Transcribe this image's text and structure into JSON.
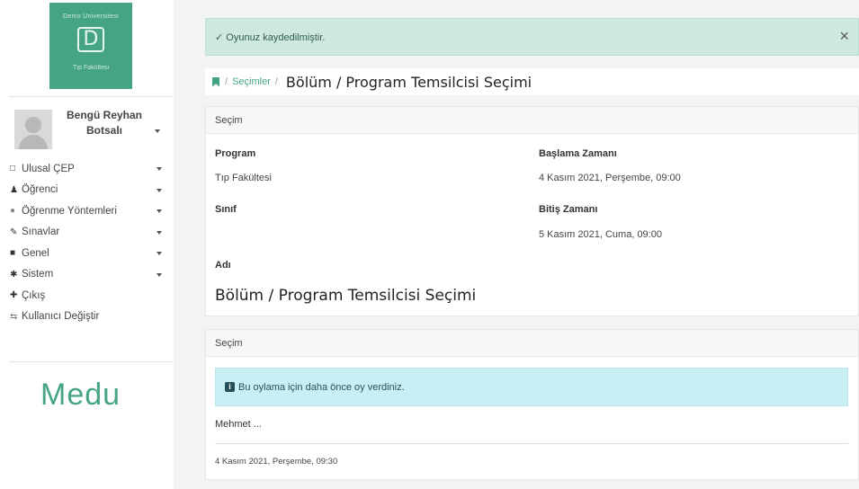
{
  "sidebar": {
    "logo": {
      "top_text": "Demo Üniversitesi",
      "letter": "D",
      "bottom_text": "Tıp Fakültesi"
    },
    "user": {
      "name": "Bengü Reyhan Botsalı"
    },
    "menu": [
      {
        "icon": "book-icon",
        "glyph": "□",
        "label": "Ulusal ÇEP",
        "has_caret": true
      },
      {
        "icon": "user-icon",
        "glyph": "♟",
        "label": "Öğrenci",
        "has_caret": true
      },
      {
        "icon": "circle-icon",
        "glyph": "●",
        "label": "Öğrenme Yöntemleri",
        "has_caret": true
      },
      {
        "icon": "edit-icon",
        "glyph": "✎",
        "label": "Sınavlar",
        "has_caret": true
      },
      {
        "icon": "folder-icon",
        "glyph": "■",
        "label": "Genel",
        "has_caret": true
      },
      {
        "icon": "asterisk-icon",
        "glyph": "✱",
        "label": "Sistem",
        "has_caret": true
      },
      {
        "icon": "signpost-icon",
        "glyph": "✚",
        "label": "Çıkış",
        "has_caret": false
      },
      {
        "icon": "switch-icon",
        "glyph": "⇆",
        "label": "Kullanıcı Değiştir",
        "has_caret": false
      }
    ],
    "brand_logo": "Medu"
  },
  "alert": {
    "message": "✓ Oyunuz kaydedilmiştir.",
    "close": "×"
  },
  "breadcrumb": {
    "link": "Seçimler",
    "separator": "/",
    "current": "Bölüm / Program Temsilcisi Seçimi"
  },
  "election_card": {
    "header": "Seçim",
    "program_label": "Program",
    "program_value": "Tıp Fakültesi",
    "start_label": "Başlama Zamanı",
    "start_value": "4 Kasım 2021, Perşembe, 09:00",
    "class_label": "Sınıf",
    "end_label": "Bitiş Zamanı",
    "end_value": "5 Kasım 2021, Cuma, 09:00",
    "name_label": "Adı",
    "name_value": "Bölüm / Program Temsilcisi Seçimi"
  },
  "vote_card": {
    "header": "Seçim",
    "info_icon": "i",
    "info_message": "Bu oylama için daha önce oy verdiniz.",
    "voter": "Mehmet ...",
    "vote_date": "4 Kasım 2021, Perşembe, 09:30"
  },
  "colors": {
    "accent": "#46a486",
    "success_bg": "#cfe8df",
    "info_bg": "#c9eef4"
  }
}
